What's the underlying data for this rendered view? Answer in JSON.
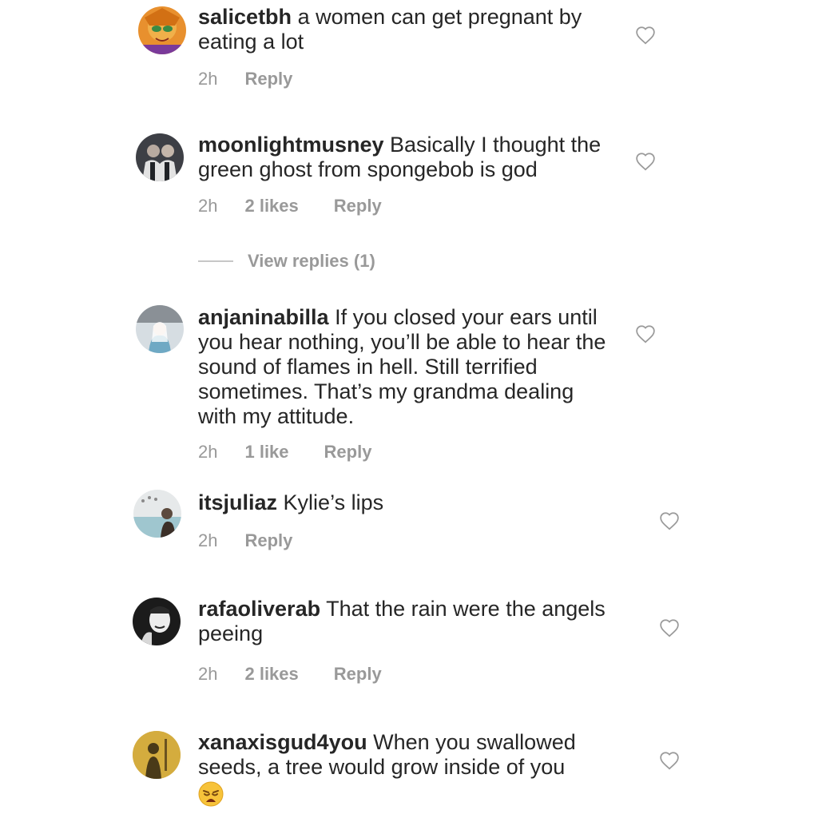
{
  "comments": [
    {
      "username": "salicetbh",
      "text": "a women can get pregnant by eating a lot",
      "time": "2h",
      "likes": "",
      "reply": "Reply",
      "avatar_icon": "cartoon-avatar",
      "avatar_colors": [
        "#e8902e",
        "#3a8a44"
      ]
    },
    {
      "username": "moonlightmusney",
      "text": "Basically I thought the green ghost from spongebob is god",
      "time": "2h",
      "likes": "2 likes",
      "reply": "Reply",
      "avatar_icon": "photo-avatar",
      "avatar_colors": [
        "#3d3f45",
        "#b8aaa0"
      ]
    },
    {
      "username": "anjaninabilla",
      "text": "If you closed your ears until you hear nothing, you’ll be able to hear the sound of flames in hell. Still terrified sometimes. That’s my grandma dealing with my attitude.",
      "time": "2h",
      "likes": "1 like",
      "reply": "Reply",
      "avatar_icon": "photo-avatar",
      "avatar_colors": [
        "#d6dde2",
        "#6fa9c4"
      ]
    },
    {
      "username": "itsjuliaz",
      "text": "Kylie’s lips",
      "time": "2h",
      "likes": "",
      "reply": "Reply",
      "avatar_icon": "photo-avatar",
      "avatar_colors": [
        "#e6e9ea",
        "#5c4a3e"
      ]
    },
    {
      "username": "rafaoliverab",
      "text": "That the rain were the angels peeing",
      "time": "2h",
      "likes": "2 likes",
      "reply": "Reply",
      "avatar_icon": "photo-avatar",
      "avatar_colors": [
        "#1b1b1b",
        "#ededed"
      ]
    },
    {
      "username": "xanaxisgud4you",
      "text": "When you swallowed seeds, a tree would grow inside of you",
      "emoji": "weary-face-emoji",
      "time": "",
      "likes": "",
      "reply": "",
      "avatar_icon": "photo-avatar",
      "avatar_colors": [
        "#c9a032",
        "#4a3a18"
      ]
    }
  ],
  "view_replies": "View replies (1)",
  "icons": {
    "like": "heart-outline-icon"
  },
  "colors": {
    "text": "#262626",
    "meta": "#999999",
    "divider": "#c7c7c7",
    "heart": "#9a9a9a"
  }
}
